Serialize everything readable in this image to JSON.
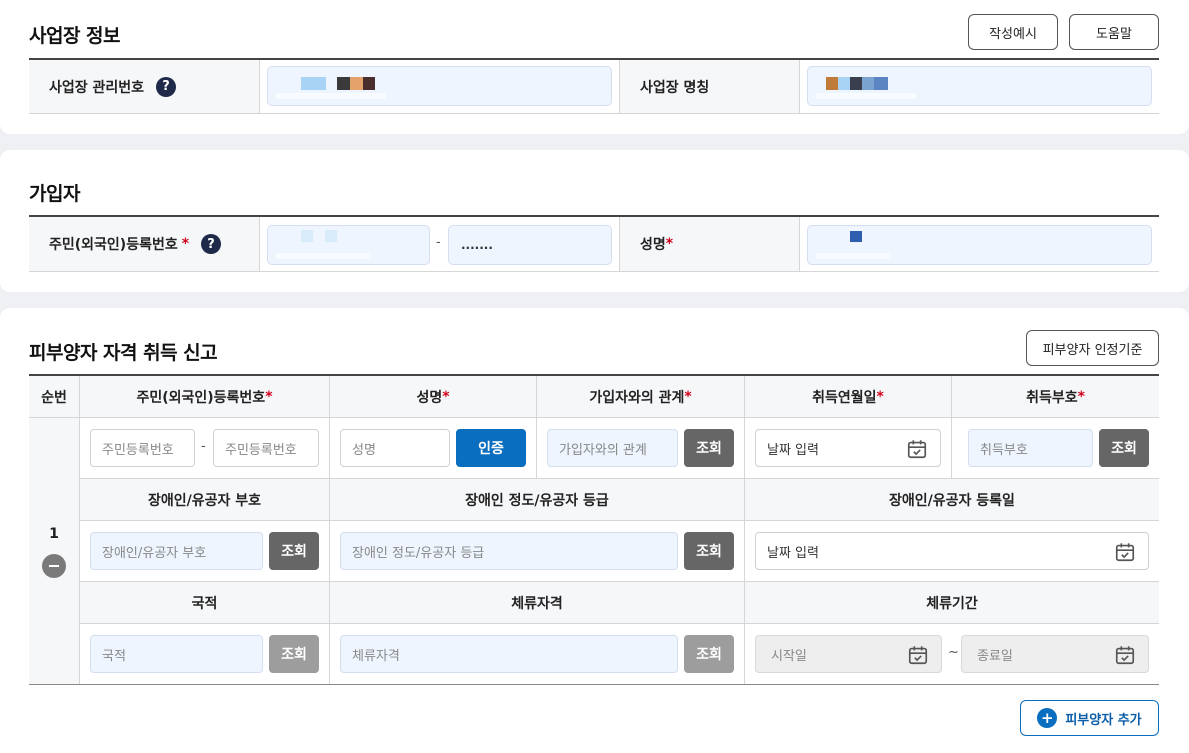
{
  "workplace": {
    "title": "사업장 정보",
    "example_button": "작성예시",
    "help_button": "도움말",
    "mgmt_no_label": "사업장 관리번호",
    "name_label": "사업장 명칭"
  },
  "subscriber": {
    "title": "가입자",
    "rrn_label": "주민(외국인)등록번호",
    "rrn_required": "*",
    "rrn_dash": "-",
    "rrn_back_masked": ".......",
    "name_label": "성명",
    "name_required": "*"
  },
  "dependent": {
    "title": "피부양자 자격 취득 신고",
    "criteria_button": "피부양자 인정기준",
    "headers": {
      "seq": "순번",
      "rrn": "주민(외국인)등록번호",
      "name": "성명",
      "relation": "가입자와의 관계",
      "acq_date": "취득연월일",
      "acq_code": "취득부호",
      "disability_code": "장애인/유공자 부호",
      "disability_grade": "장애인 정도/유공자 등급",
      "disability_date": "장애인/유공자 등록일",
      "nationality": "국적",
      "stay_status": "체류자격",
      "stay_period": "체류기간"
    },
    "required_mark": "*",
    "row": {
      "seq": "1",
      "rrn_front_placeholder": "주민등록번호",
      "rrn_back_placeholder": "주민등록번호",
      "dash": "-",
      "name_placeholder": "성명",
      "verify_button": "인증",
      "relation_placeholder": "가입자와의 관계",
      "lookup_button": "조회",
      "date_placeholder": "날짜 입력",
      "acq_code_placeholder": "취득부호",
      "disability_code_placeholder": "장애인/유공자 부호",
      "disability_grade_placeholder": "장애인 정도/유공자 등급",
      "nationality_placeholder": "국적",
      "stay_status_placeholder": "체류자격",
      "start_placeholder": "시작일",
      "tilde": "~",
      "end_placeholder": "종료일"
    },
    "add_button": "피부양자 추가"
  },
  "colors": {
    "accent": "#0a6ec0",
    "required": "#d0021b",
    "field_bg": "#eef5fe"
  }
}
